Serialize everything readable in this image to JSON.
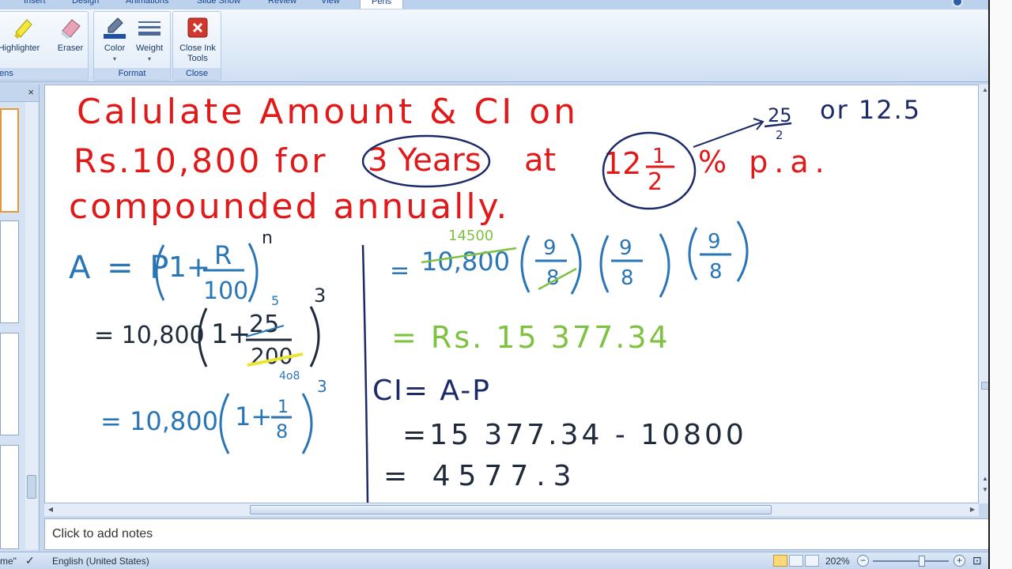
{
  "ribbon": {
    "tabs": [
      "Insert",
      "Design",
      "Animations",
      "Slide Show",
      "Review",
      "View",
      "Pens"
    ],
    "active_tab": "Pens",
    "groups": {
      "pens_label": "ens",
      "format_label": "Format",
      "close_label": "Close"
    },
    "buttons": {
      "highlighter": "Highlighter",
      "eraser": "Eraser",
      "color": "Color",
      "weight": "Weight",
      "close_ink_line1": "Close Ink",
      "close_ink_line2": "Tools"
    }
  },
  "thumbnails": {
    "close_glyph": "×",
    "count": 4
  },
  "slide": {
    "ink": {
      "problem_line1": "Calulate Amount & CI on",
      "problem_line2a": "Rs.10,800 for",
      "problem_years": "3 Years",
      "problem_at": "at",
      "problem_rate_whole": "12",
      "problem_rate_num": "1",
      "problem_rate_den": "2",
      "problem_pa": "% p.a.",
      "problem_line3": "compounded annually.",
      "side_note_num": "25",
      "side_note_den": "2",
      "side_note_rest": "or 12.5",
      "formula_A": "A = P",
      "formula_R": "R",
      "formula_100": "100",
      "formula_n": "n",
      "step1_lhs": "= 10,800",
      "step1_num": "25",
      "step1_den": "200",
      "step1_cancel_num": "5",
      "step1_cancel_den": "4o8",
      "step1_pow": "3",
      "step2_lhs": "= 10,800",
      "step2_num": "1",
      "step2_den": "8",
      "step2_pow": "3",
      "right_eq": "=",
      "right_10800": "10,800",
      "right_cancel": "14500",
      "right_9": "9",
      "right_8": "8",
      "right_result": "= Rs. 15 377.34",
      "ci_def": "CI= A-P",
      "ci_step": "=15 377.34 - 10800",
      "ci_result": "= 4577.3"
    }
  },
  "notes": {
    "placeholder": "Click to add notes"
  },
  "status": {
    "theme_fragment": "me\"",
    "language": "English (United States)",
    "zoom": "202%",
    "zoom_percent": 202
  },
  "colors": {
    "ink_red": "#e01a1a",
    "ink_blue": "#2a75b5",
    "ink_navy": "#1d2a68",
    "ink_green": "#7fc241",
    "ink_black": "#1f2a3a"
  }
}
